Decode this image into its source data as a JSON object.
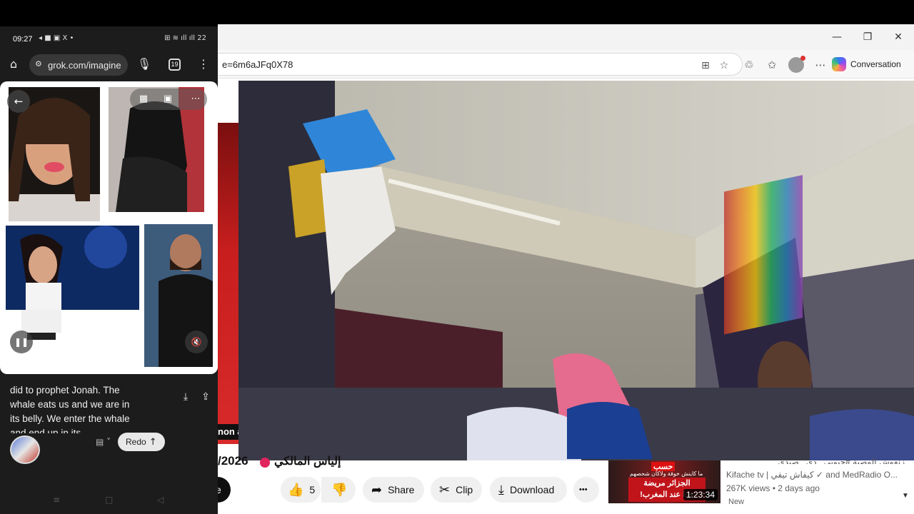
{
  "browser": {
    "window_controls": {
      "minimize": "—",
      "restore": "❐",
      "close": "✕"
    },
    "address": "e=6m6aJFq0X78",
    "copilot_label": "Conversation"
  },
  "video": {
    "overlay_caption": "non a",
    "title_prefix": "/2026",
    "title_arabic": "إلياس المالكي"
  },
  "actions": {
    "like_count": "5",
    "share": "Share",
    "clip": "Clip",
    "download": "Download",
    "more": "•••"
  },
  "related": {
    "title_partial": "زنقوش الوصية #جيوبي_ دي_ صيدي",
    "channel": "Kifache tv | كيفاش تيفي ✓ and MedRadio O...",
    "meta": "267K views • 2 days ago",
    "badge": "New",
    "duration": "1:23:34",
    "thumb_top": "حسب",
    "thumb_sub": "ما كاينش خوفة ولاكان شحصهم",
    "thumb_banner_1": "الجزائر مريضة",
    "thumb_banner_2": "جدا عند المغرب!"
  },
  "phone": {
    "time": "09:27",
    "status_left_icons": "◂ ■ ▣ X •",
    "status_right_icons": "⊞ ≋ ıll ıll 22",
    "url": "grok.com/imagine",
    "tab_count": "19",
    "chat_text": "did to prophet Jonah. The whale eats us and we are in its belly. We enter the whale and end up in its",
    "redo_label": "Redo"
  },
  "colors": {
    "accent_red": "#e0245e",
    "youtube_red": "#c0141a"
  }
}
